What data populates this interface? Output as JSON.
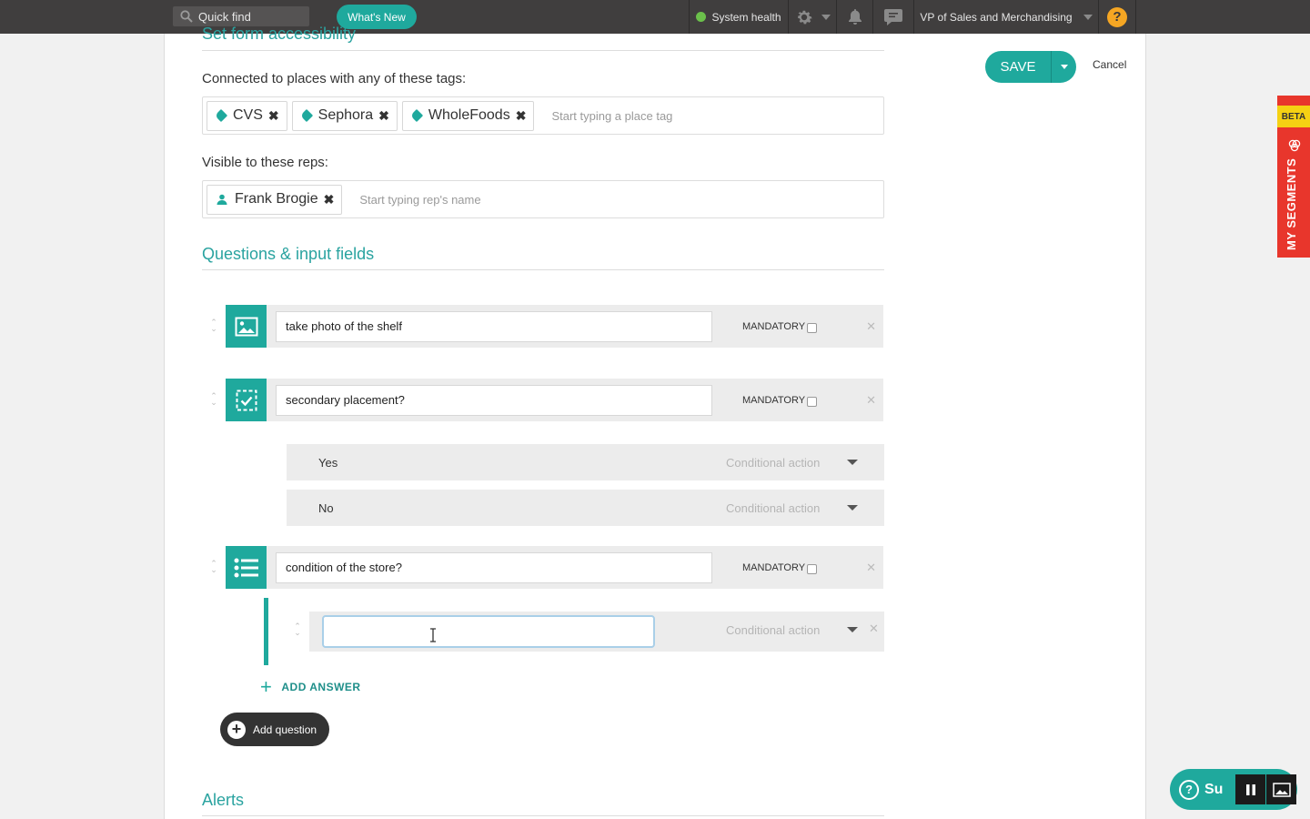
{
  "topbar": {
    "quick_find_placeholder": "Quick find",
    "whats_new": "What's New",
    "system_health": "System health",
    "user_role": "VP of Sales and Merchandising",
    "help": "?"
  },
  "header": {
    "section_title": "Set form accessibility",
    "save_label": "SAVE",
    "cancel_label": "Cancel"
  },
  "places": {
    "label": "Connected to places with any of these tags:",
    "tags": [
      "CVS",
      "Sephora",
      "WholeFoods"
    ],
    "placeholder": "Start typing a place tag"
  },
  "reps": {
    "label": "Visible to these reps:",
    "tags": [
      "Frank Brogie"
    ],
    "placeholder": "Start typing rep's name"
  },
  "questions": {
    "title": "Questions & input fields",
    "mandatory_label": "MANDATORY",
    "items": [
      {
        "text": "take photo of the shelf",
        "icon": "image-icon"
      },
      {
        "text": "secondary placement?",
        "icon": "checkbox-icon"
      },
      {
        "text": "condition of the store?",
        "icon": "list-icon"
      }
    ],
    "options": [
      {
        "label": "Yes",
        "action": "Conditional action"
      },
      {
        "label": "No",
        "action": "Conditional action"
      }
    ],
    "answer": {
      "value": "",
      "action": "Conditional action"
    },
    "add_answer": "ADD ANSWER",
    "add_question": "Add question"
  },
  "alerts": {
    "title": "Alerts"
  },
  "segments": {
    "beta": "BETA",
    "label": "MY SEGMENTS"
  },
  "support": {
    "label": "Su"
  },
  "colors": {
    "accent": "#1fa99d",
    "topbar": "#403e3e",
    "segment_tab": "#e8362c",
    "beta": "#f5d113"
  }
}
